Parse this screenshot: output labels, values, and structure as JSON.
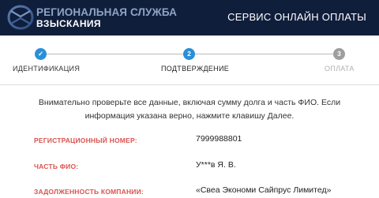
{
  "header": {
    "brand_line1": "РЕГИОНАЛЬНАЯ СЛУЖБА",
    "brand_line2": "ВЗЫСКАНИЯ",
    "service_title": "СЕРВИС ОНЛАЙН ОПЛАТЫ",
    "logo_icon": "rsv-logo-icon"
  },
  "steps": [
    {
      "label": "ИДЕНТИФИКАЦИЯ",
      "marker": "✓",
      "state": "completed"
    },
    {
      "label": "ПОДТВЕРЖДЕНИЕ",
      "marker": "2",
      "state": "active"
    },
    {
      "label": "ОПЛАТА",
      "marker": "3",
      "state": "pending"
    }
  ],
  "instructions": "Внимательно проверьте все данные, включая сумму долга и часть ФИО. Если информация указана верно, нажмите клавишу Далее.",
  "fields": [
    {
      "label": "РЕГИСТРАЦИОННЫЙ НОМЕР:",
      "value": "7999988801"
    },
    {
      "label": "ЧАСТЬ ФИО:",
      "value": "У***в Я. В."
    },
    {
      "label": "ЗАДОЛЖЕННОСТЬ КОМПАНИИ:",
      "value": "«Свеа Экономи Сайпрус Лимитед»"
    }
  ],
  "colors": {
    "header_bg": "#0f1e3b",
    "step_active": "#2a8fd8",
    "step_pending": "#9e9e9e",
    "label_red": "#d9534f"
  }
}
